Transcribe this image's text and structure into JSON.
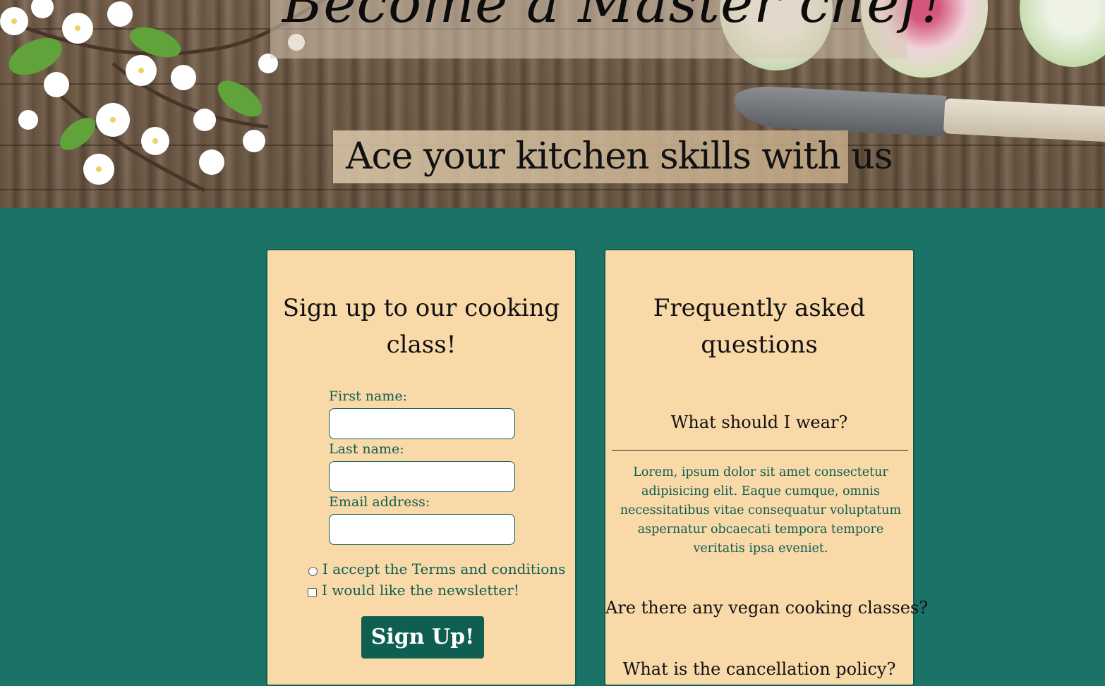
{
  "hero": {
    "title": "Become a Master chef!",
    "subtitle": "Ace your kitchen skills with us"
  },
  "signup": {
    "heading_line1": "Sign up to our cooking",
    "heading_line2": "class!",
    "first_name_label": "First name:",
    "first_name_value": "",
    "last_name_label": "Last name:",
    "last_name_value": "",
    "email_label": "Email address:",
    "email_value": "",
    "terms_label": "I accept the Terms and conditions",
    "newsletter_label": "I would like the newsletter!",
    "button_label": "Sign Up!"
  },
  "faq": {
    "heading_line1": "Frequently asked",
    "heading_line2": "questions",
    "items": [
      {
        "question": "What should I wear?",
        "answer": "Lorem, ipsum dolor sit amet consectetur adipisicing elit. Eaque cumque, omnis necessitatibus vitae consequatur voluptatum aspernatur obcaecati tempora tempore veritatis ipsa eveniet."
      },
      {
        "question": "Are there any vegan cooking classes?"
      },
      {
        "question": "What is the cancellation policy?"
      }
    ]
  },
  "colors": {
    "page_background": "#1a7366",
    "card_background": "#f9d9a8",
    "accent": "#0e5e52"
  }
}
